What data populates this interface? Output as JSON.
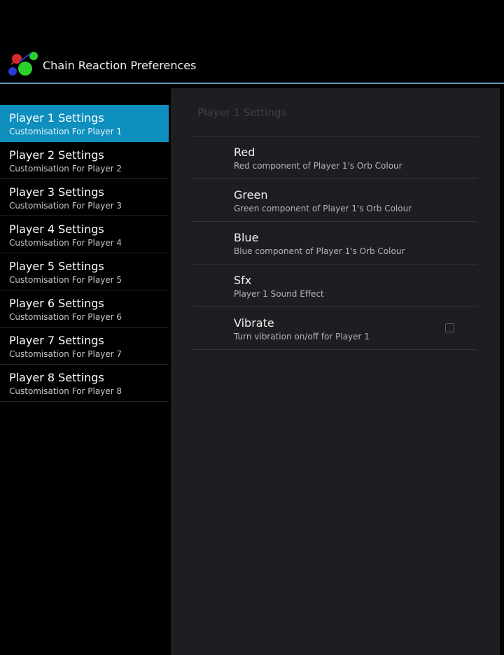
{
  "action_bar": {
    "title": "Chain Reaction Preferences",
    "icon": "chain-reaction-orbs-icon"
  },
  "headers": [
    {
      "title": "Player 1 Settings",
      "summary": "Customisation For Player 1",
      "selected": true
    },
    {
      "title": "Player 2 Settings",
      "summary": "Customisation For Player 2",
      "selected": false
    },
    {
      "title": "Player 3 Settings",
      "summary": "Customisation For Player 3",
      "selected": false
    },
    {
      "title": "Player 4 Settings",
      "summary": "Customisation For Player 4",
      "selected": false
    },
    {
      "title": "Player 5 Settings",
      "summary": "Customisation For Player 5",
      "selected": false
    },
    {
      "title": "Player 6 Settings",
      "summary": "Customisation For Player 6",
      "selected": false
    },
    {
      "title": "Player 7 Settings",
      "summary": "Customisation For Player 7",
      "selected": false
    },
    {
      "title": "Player 8 Settings",
      "summary": "Customisation For Player 8",
      "selected": false
    }
  ],
  "detail": {
    "category_title": "Player 1 Settings",
    "preferences": [
      {
        "title": "Red",
        "summary": "Red component of Player 1's Orb Colour"
      },
      {
        "title": "Green",
        "summary": "Green component of Player 1's Orb Colour"
      },
      {
        "title": "Blue",
        "summary": "Blue component of Player 1's Orb Colour"
      },
      {
        "title": "Sfx",
        "summary": "Player 1 Sound Effect"
      },
      {
        "title": "Vibrate",
        "summary": "Turn vibration on/off for Player 1",
        "checked": false
      }
    ]
  },
  "colors": {
    "accent": "#0e8fbd",
    "action_bar_divider": "#5f9bb3",
    "detail_background": "#1d1e21"
  }
}
